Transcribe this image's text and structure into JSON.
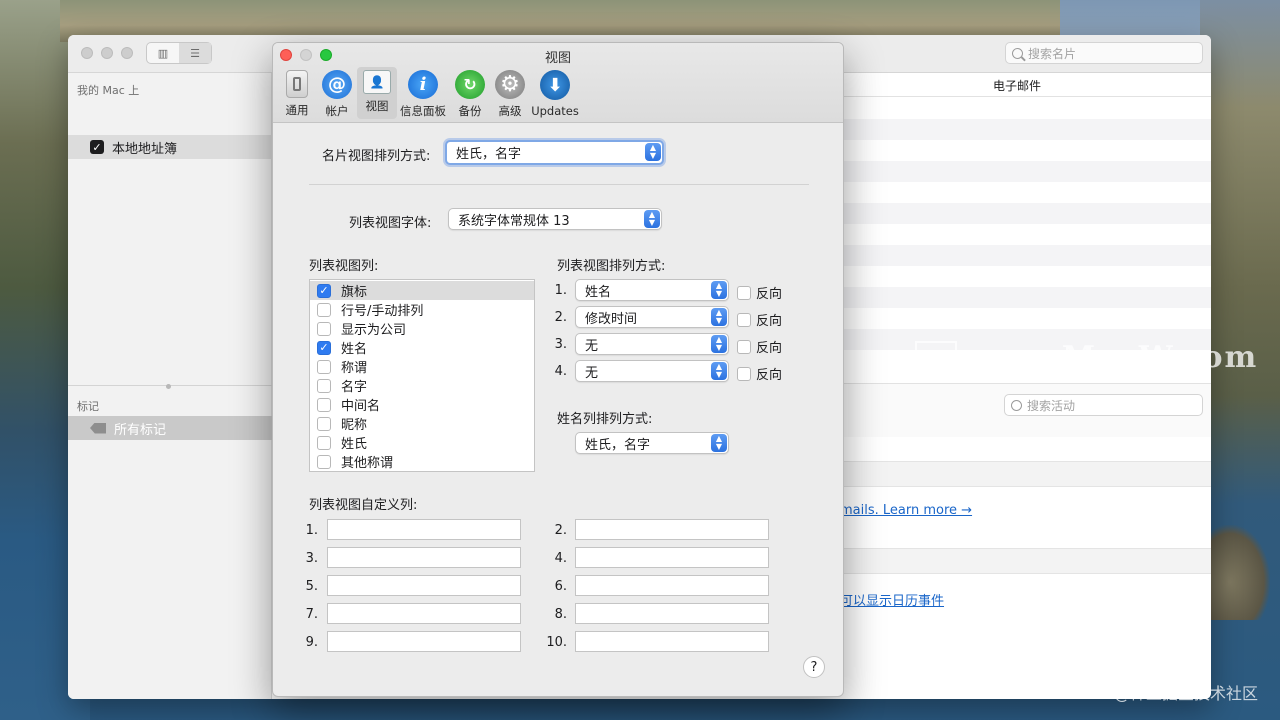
{
  "contacts": {
    "search_placeholder": "搜索名片",
    "sidebar_header_mac": "我的 Mac 上",
    "sidebar_item_local": "本地地址簿",
    "sidebar_header_tags": "标记",
    "sidebar_item_all_tags": "所有标记",
    "column_email": "电子邮件",
    "activity_search_placeholder": "搜索活动",
    "link_learn_more": "mails. Learn more →",
    "link_calendar": "可以显示日历事件"
  },
  "watermark": "www.MacW.com",
  "credit": "@稀土掘金技术社区",
  "prefs": {
    "title": "视图",
    "toolbar": [
      {
        "label": "通用",
        "icon": "switch-icon"
      },
      {
        "label": "帐户",
        "icon": "at-sign-icon"
      },
      {
        "label": "视图",
        "icon": "card-view-icon"
      },
      {
        "label": "信息面板",
        "icon": "info-icon"
      },
      {
        "label": "备份",
        "icon": "backup-icon"
      },
      {
        "label": "高级",
        "icon": "gear-icon"
      },
      {
        "label": "Updates",
        "icon": "download-icon"
      }
    ],
    "card_sort_label": "名片视图排列方式:",
    "card_sort_value": "姓氏，名字",
    "font_label": "列表视图字体:",
    "font_value": "系统字体常规体 13",
    "list_columns_label": "列表视图列:",
    "list_columns": [
      {
        "label": "旗标",
        "checked": true
      },
      {
        "label": "行号/手动排列",
        "checked": false
      },
      {
        "label": "显示为公司",
        "checked": false
      },
      {
        "label": "姓名",
        "checked": true
      },
      {
        "label": "称谓",
        "checked": false
      },
      {
        "label": "名字",
        "checked": false
      },
      {
        "label": "中间名",
        "checked": false
      },
      {
        "label": "昵称",
        "checked": false
      },
      {
        "label": "姓氏",
        "checked": false
      },
      {
        "label": "其他称谓",
        "checked": false
      }
    ],
    "list_sort_label": "列表视图排列方式:",
    "list_sort": [
      {
        "num": "1.",
        "value": "姓名",
        "reverse": "反向"
      },
      {
        "num": "2.",
        "value": "修改时间",
        "reverse": "反向"
      },
      {
        "num": "3.",
        "value": "无",
        "reverse": "反向"
      },
      {
        "num": "4.",
        "value": "无",
        "reverse": "反向"
      }
    ],
    "name_sort_label": "姓名列排列方式:",
    "name_sort_value": "姓氏，名字",
    "custom_columns_label": "列表视图自定义列:",
    "custom_left": [
      "1.",
      "3.",
      "5.",
      "7.",
      "9."
    ],
    "custom_right": [
      "2.",
      "4.",
      "6.",
      "8.",
      "10."
    ],
    "help": "?"
  }
}
